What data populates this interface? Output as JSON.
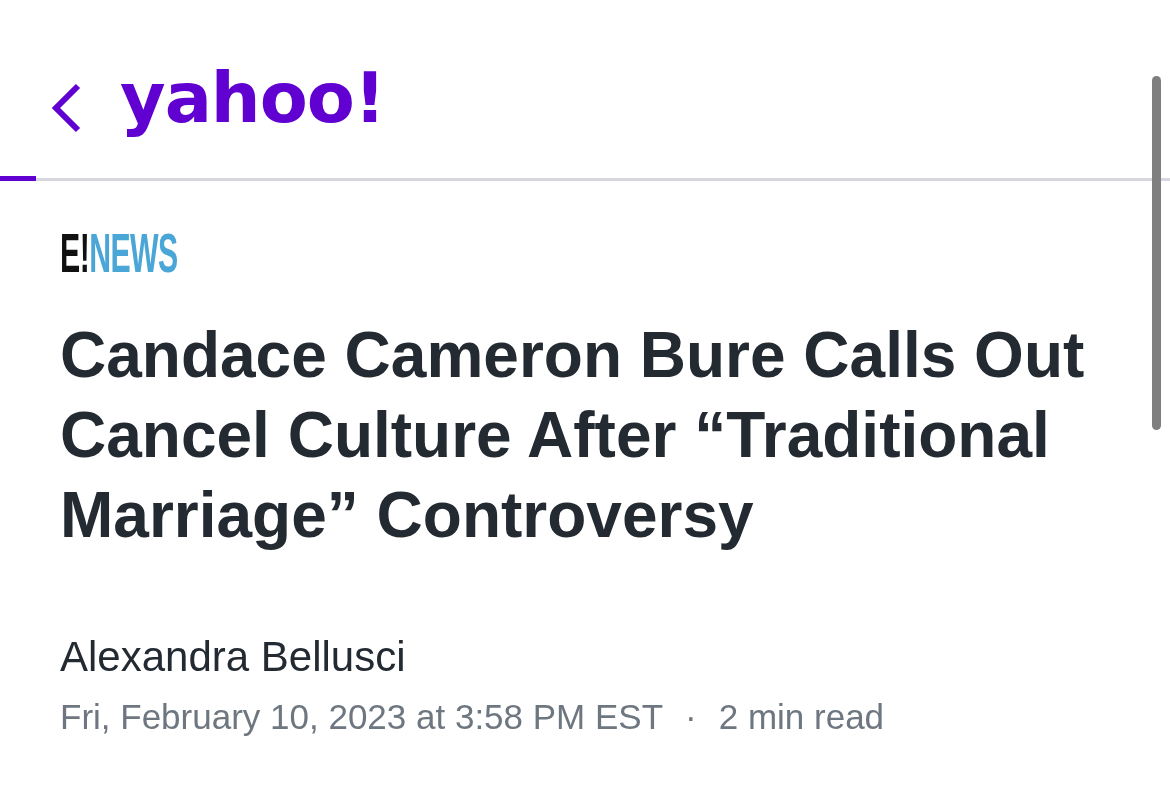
{
  "header": {
    "logo": "yahoo!"
  },
  "reading_progress": {
    "level": 0.031
  },
  "article": {
    "source": {
      "logo_mark": "E!",
      "logo_name": "NEWS"
    },
    "headline": "Candace Cameron Bure Calls Out Cancel Culture After “Traditional Marriage” Controversy",
    "author": "Alexandra Bellusci",
    "published": "Fri, February 10, 2023 at 3:58 PM EST",
    "separator": "·",
    "read_time": "2 min read"
  }
}
